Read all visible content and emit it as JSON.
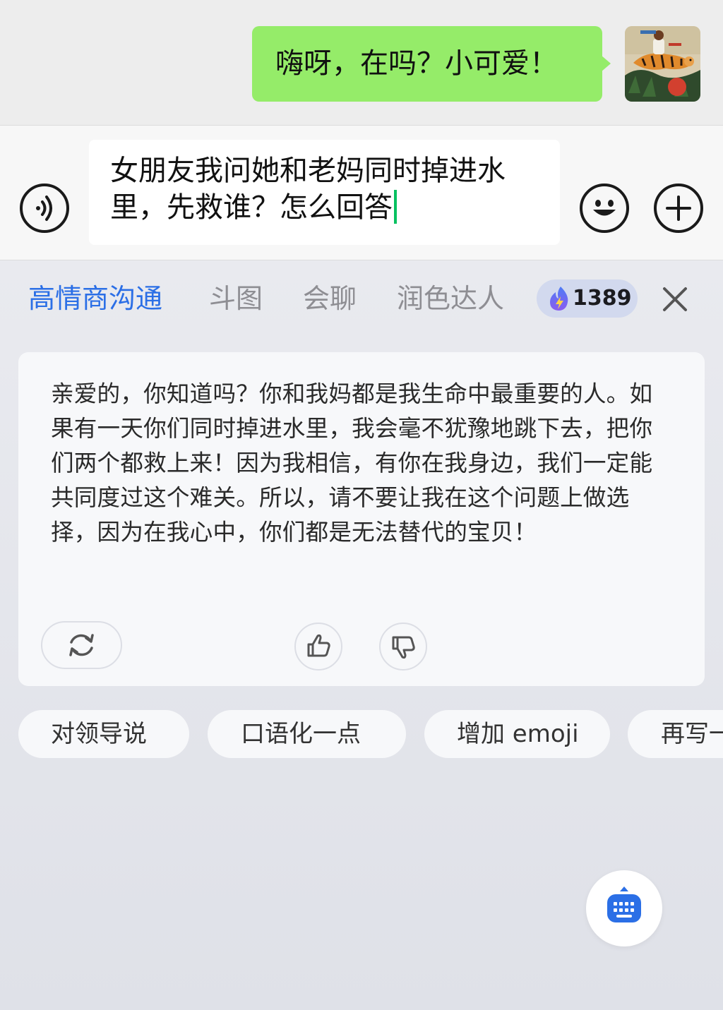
{
  "chat": {
    "message": "嗨呀，在吗？小可爱！",
    "bubble_color": "#95ec69",
    "avatar_icon": "tiger-rider-avatar"
  },
  "input": {
    "text": "女朋友我问她和老妈同时掉进水里，先救谁？怎么回答",
    "caret_color": "#07c160",
    "voice_icon": "voice-icon",
    "emoji_icon": "emoji-icon",
    "plus_icon": "plus-icon"
  },
  "assistant": {
    "tabs": [
      {
        "label": "高情商沟通",
        "active": true
      },
      {
        "label": "斗图",
        "active": false
      },
      {
        "label": "会聊",
        "active": false
      },
      {
        "label": "润色达人",
        "active": false
      }
    ],
    "points": "1389",
    "points_icon": "flame-icon",
    "close_icon": "close-icon",
    "active_color": "#2b6fe6",
    "reply": "亲爱的，你知道吗？你和我妈都是我生命中最重要的人。如果有一天你们同时掉进水里，我会毫不犹豫地跳下去，把你们两个都救上来！因为我相信，有你在我身边，我们一定能共同度过这个难关。所以，请不要让我在这个问题上做选择，因为在我心中，你们都是无法替代的宝贝！",
    "actions": [
      "refresh-icon",
      "thumbs-up-icon",
      "thumbs-down-icon"
    ],
    "chips": [
      "对领导说",
      "口语化一点",
      "增加 emoji",
      "再写一"
    ],
    "keyboard_icon": "keyboard-icon"
  }
}
